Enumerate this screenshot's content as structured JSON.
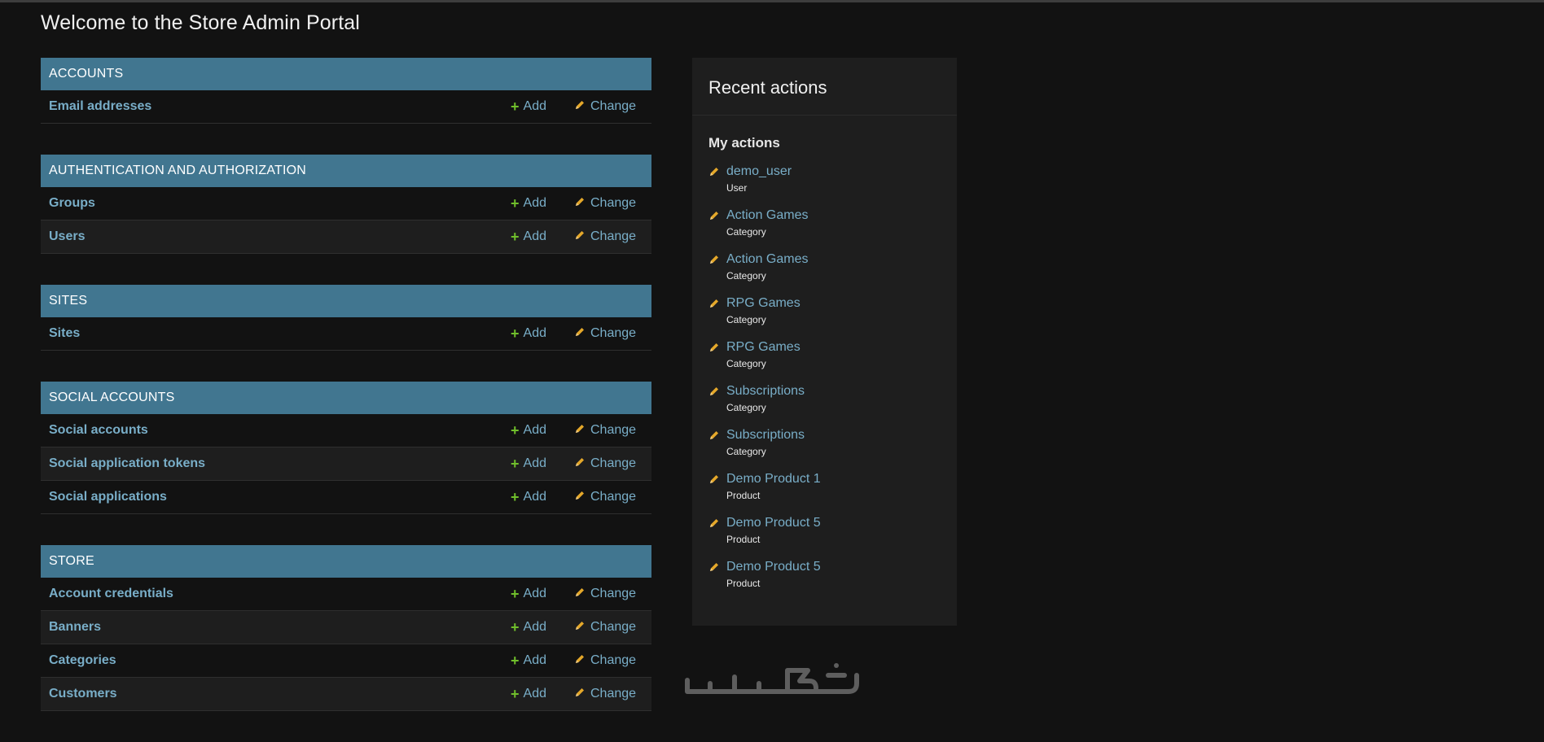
{
  "page_title": "Welcome to the Store Admin Portal",
  "add_label": "Add",
  "change_label": "Change",
  "modules": [
    {
      "name": "ACCOUNTS",
      "models": [
        "Email addresses"
      ]
    },
    {
      "name": "AUTHENTICATION AND AUTHORIZATION",
      "models": [
        "Groups",
        "Users"
      ]
    },
    {
      "name": "SITES",
      "models": [
        "Sites"
      ]
    },
    {
      "name": "SOCIAL ACCOUNTS",
      "models": [
        "Social accounts",
        "Social application tokens",
        "Social applications"
      ]
    },
    {
      "name": "STORE",
      "models": [
        "Account credentials",
        "Banners",
        "Categories",
        "Customers"
      ]
    }
  ],
  "recent": {
    "title": "Recent actions",
    "subtitle": "My actions",
    "items": [
      {
        "name": "demo_user",
        "type": "User"
      },
      {
        "name": "Action Games",
        "type": "Category"
      },
      {
        "name": "Action Games",
        "type": "Category"
      },
      {
        "name": "RPG Games",
        "type": "Category"
      },
      {
        "name": "RPG Games",
        "type": "Category"
      },
      {
        "name": "Subscriptions",
        "type": "Category"
      },
      {
        "name": "Subscriptions",
        "type": "Category"
      },
      {
        "name": "Demo Product 1",
        "type": "Product"
      },
      {
        "name": "Demo Product 5",
        "type": "Product"
      },
      {
        "name": "Demo Product 5",
        "type": "Product"
      }
    ]
  },
  "colors": {
    "background": "#121212",
    "module_header": "#417690",
    "link": "#79aec8",
    "add_icon": "#70bf2b",
    "change_icon": "#e5a82a"
  },
  "icons": {
    "add": "plus-icon",
    "change": "pencil-icon",
    "watermark": "khamsat-logo"
  }
}
